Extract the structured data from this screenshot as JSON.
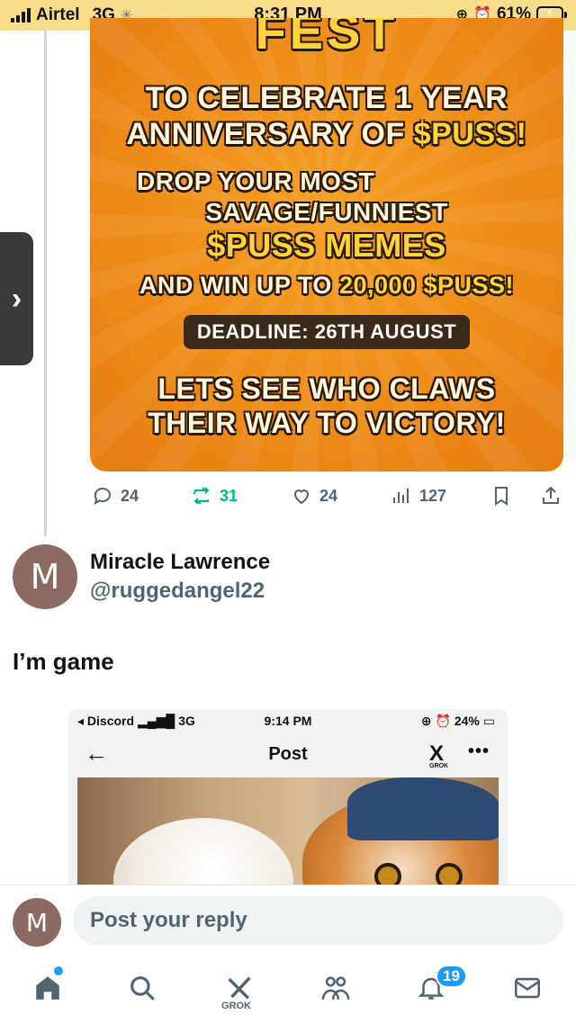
{
  "status_bar": {
    "carrier": "Airtel",
    "network": "3G",
    "time": "8:31 PM",
    "battery": "61%",
    "battery_level": 0.61
  },
  "promo": {
    "title_fragment": "FEST",
    "line1": "TO CELEBRATE 1 YEAR",
    "line2a": "ANNIVERSARY OF ",
    "line2b": "$PUSS!",
    "line3": "DROP YOUR MOST",
    "line4": "SAVAGE/FUNNIEST",
    "line5": "$PUSS MEMES",
    "line6a": "AND WIN UP TO ",
    "line6b": "20,000 $PUSS!",
    "deadline": "DEADLINE: 26TH AUGUST",
    "line7": "LETS SEE WHO CLAWS",
    "line8": "THEIR WAY TO VICTORY!"
  },
  "side_tab": {
    "icon": "chevron-right-icon",
    "glyph": "›"
  },
  "tweet_actions": {
    "replies": "24",
    "reposts": "31",
    "likes": "24",
    "views": "127"
  },
  "reply_tweet": {
    "avatar_initial": "M",
    "name": "Miracle Lawrence",
    "handle": "@ruggedangel22",
    "text": "I’m game"
  },
  "embedded": {
    "status_left": "◂ Discord",
    "network": "3G",
    "time": "9:14 PM",
    "battery": "24%",
    "back": "←",
    "title": "Post",
    "grok": "GROK",
    "more": "•••"
  },
  "composer": {
    "avatar_initial": "M",
    "placeholder": "Post your reply"
  },
  "bottom_nav": {
    "grok_label": "GROK",
    "notifications_badge": "19"
  },
  "colors": {
    "accent": "#1d9bf0",
    "repost_green": "#00ba7c",
    "promo_orange": "#ee8c18",
    "status_bar": "#f7dd8a"
  }
}
